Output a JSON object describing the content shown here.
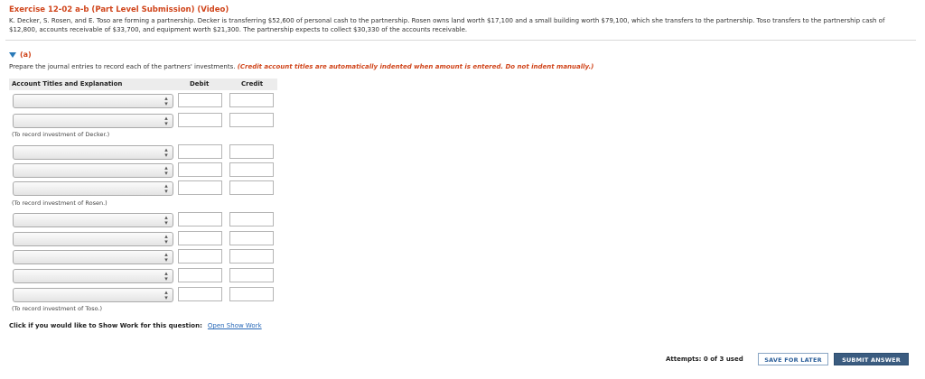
{
  "exercise": {
    "title": "Exercise 12-02 a-b (Part Level Submission) (Video)",
    "problem_text": "K. Decker, S. Rosen, and E. Toso are forming a partnership. Decker is transferring $52,600 of personal cash to the partnership. Rosen owns land worth $17,100 and a small building worth $79,100, which she transfers to the partnership. Toso transfers to the partnership cash of $12,800, accounts receivable of $33,700, and equipment worth $21,300. The partnership expects to collect $30,330 of the accounts receivable."
  },
  "part": {
    "label": "(a)",
    "instruction": "Prepare the journal entries to record each of the partners' investments.",
    "instruction_note": "(Credit account titles are automatically indented when amount is entered. Do not indent manually.)"
  },
  "table": {
    "headers": {
      "account": "Account Titles and Explanation",
      "debit": "Debit",
      "credit": "Credit"
    },
    "notes": {
      "decker": "(To record investment of Decker.)",
      "rosen": "(To record investment of Rosen.)",
      "toso": "(To record investment of Toso.)"
    }
  },
  "show_work": {
    "prompt": "Click if you would like to Show Work for this question:",
    "link": "Open Show Work"
  },
  "footer": {
    "attempts": "Attempts: 0 of 3 used",
    "save_later": "SAVE FOR LATER",
    "submit": "SUBMIT ANSWER"
  },
  "colors": {
    "accent_red": "#d0451b",
    "link_blue": "#2a6ab8",
    "submit_bg": "#3b5c80"
  },
  "icons": {
    "collapse": "triangle-down-icon",
    "select_arrow": "updown-arrow-icon"
  }
}
